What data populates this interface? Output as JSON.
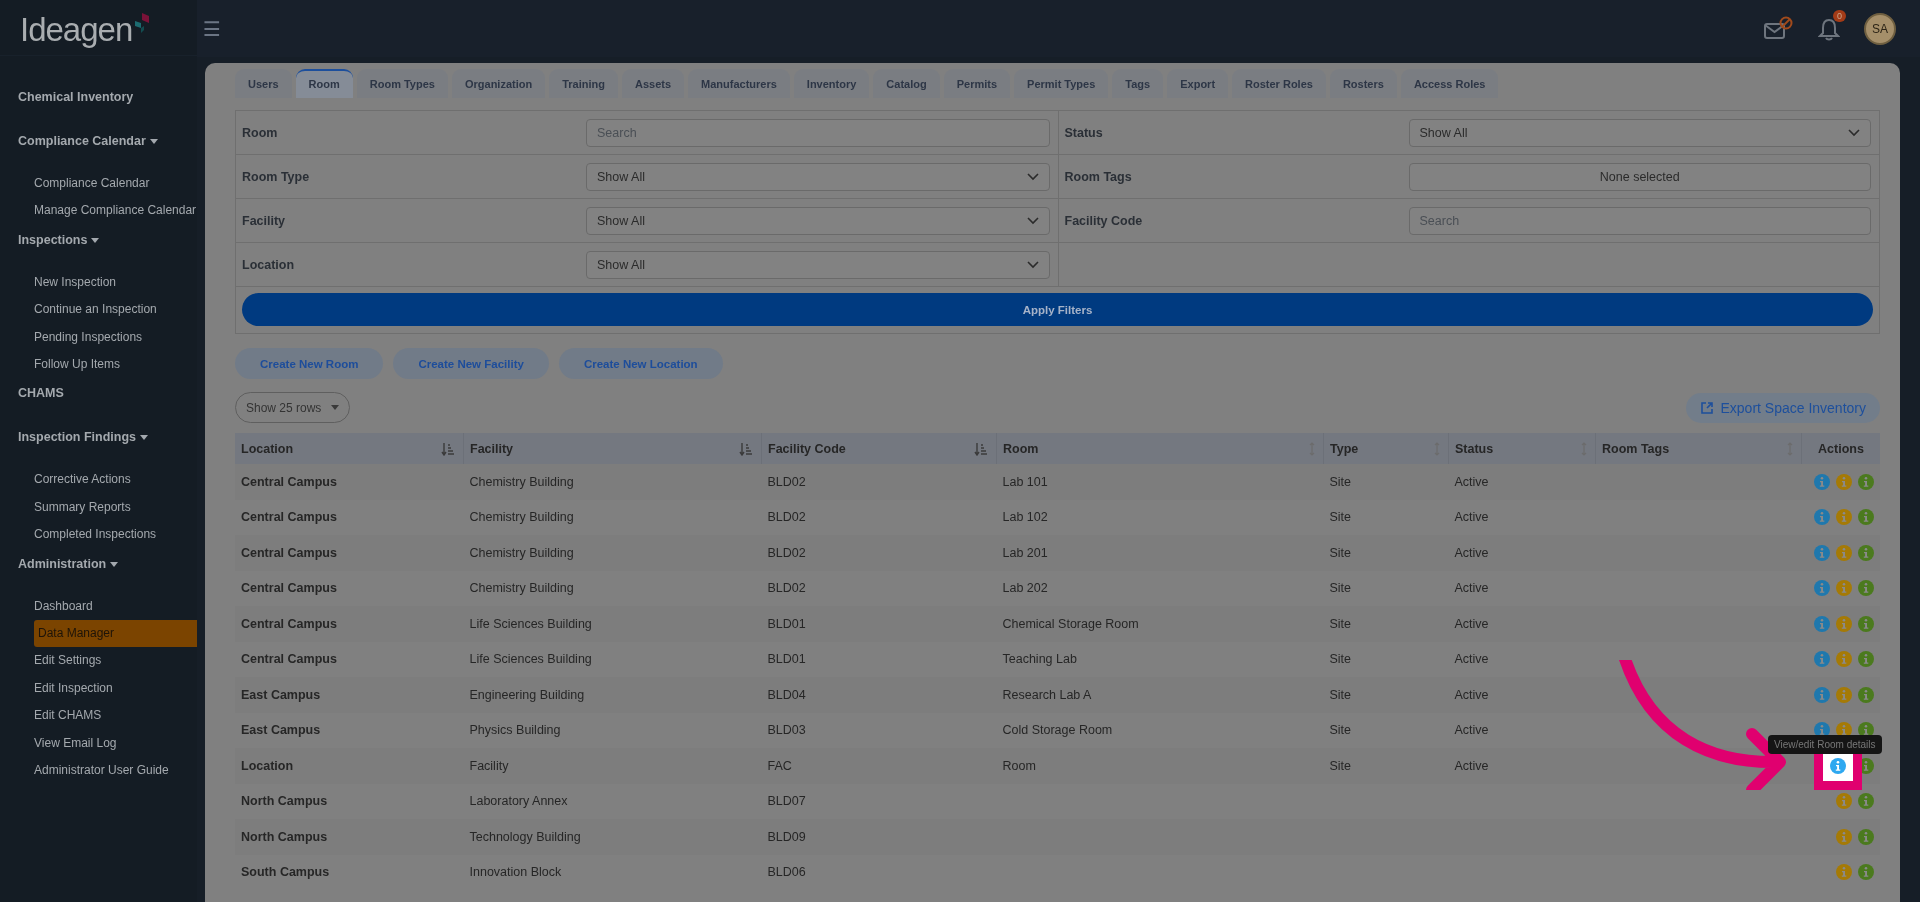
{
  "brand": {
    "logo": "Ideagen"
  },
  "top_bar": {
    "menu_icon": "☰",
    "notifications": {
      "count": "0"
    },
    "avatar": "SA"
  },
  "sidebar": {
    "sections": [
      {
        "title": "Chemical Inventory"
      },
      {
        "title": "Compliance Calendar",
        "items": [
          {
            "label": "Compliance Calendar",
            "selected": false
          },
          {
            "label": "Manage Compliance Calendar",
            "selected": false
          }
        ]
      },
      {
        "title": "Inspections",
        "items": [
          {
            "label": "New Inspection",
            "selected": false
          },
          {
            "label": "Continue an Inspection",
            "selected": false
          },
          {
            "label": "Pending Inspections",
            "selected": false
          },
          {
            "label": "Follow Up Items",
            "selected": false
          }
        ]
      },
      {
        "title": "CHAMS"
      },
      {
        "title": "Inspection Findings",
        "items": [
          {
            "label": "Corrective Actions",
            "selected": false
          },
          {
            "label": "Summary Reports",
            "selected": false
          },
          {
            "label": "Completed Inspections",
            "selected": false
          }
        ]
      },
      {
        "title": "Administration",
        "items": [
          {
            "label": "Dashboard",
            "selected": false
          },
          {
            "label": "Data Manager",
            "selected": true
          },
          {
            "label": "Edit Settings",
            "selected": false
          },
          {
            "label": "Edit Inspection",
            "selected": false
          },
          {
            "label": "Edit CHAMS",
            "selected": false
          },
          {
            "label": "View Email Log",
            "selected": false
          },
          {
            "label": "Administrator User Guide",
            "selected": false
          }
        ]
      }
    ]
  },
  "tabs": [
    {
      "label": "Users",
      "selected": false
    },
    {
      "label": "Room",
      "selected": true
    },
    {
      "label": "Room Types",
      "selected": false
    },
    {
      "label": "Organization",
      "selected": false
    },
    {
      "label": "Training",
      "selected": false
    },
    {
      "label": "Assets",
      "selected": false
    },
    {
      "label": "Manufacturers",
      "selected": false
    },
    {
      "label": "Inventory",
      "selected": false
    },
    {
      "label": "Catalog",
      "selected": false
    },
    {
      "label": "Permits",
      "selected": false
    },
    {
      "label": "Permit Types",
      "selected": false
    },
    {
      "label": "Tags",
      "selected": false
    },
    {
      "label": "Export",
      "selected": false
    },
    {
      "label": "Roster Roles",
      "selected": false
    },
    {
      "label": "Rosters",
      "selected": false
    },
    {
      "label": "Access Roles",
      "selected": false
    }
  ],
  "filters": [
    {
      "left": {
        "label": "Room",
        "kind": "text",
        "placeholder": "Search"
      },
      "right": {
        "label": "Status",
        "kind": "select",
        "value": "Show All"
      }
    },
    {
      "left": {
        "label": "Room Type",
        "kind": "select",
        "value": "Show All"
      },
      "right": {
        "label": "Room Tags",
        "kind": "multiselect",
        "value": "None selected"
      }
    },
    {
      "left": {
        "label": "Facility",
        "kind": "select",
        "value": "Show All"
      },
      "right": {
        "label": "Facility Code",
        "kind": "text",
        "placeholder": "Search"
      }
    },
    {
      "left": {
        "label": "Location",
        "kind": "select",
        "value": "Show All"
      }
    }
  ],
  "apply_button": "Apply Filters",
  "create_buttons": [
    "Create New Room",
    "Create New Facility",
    "Create New Location"
  ],
  "page_size": "Show 25 rows",
  "export_button": "Export Space Inventory",
  "table": {
    "columns": [
      {
        "label": "Location",
        "kind": "sorted"
      },
      {
        "label": "Facility",
        "kind": "sorted"
      },
      {
        "label": "Facility Code",
        "kind": "sorted"
      },
      {
        "label": "Room",
        "kind": "sortable"
      },
      {
        "label": "Type",
        "kind": "sortable"
      },
      {
        "label": "Status",
        "kind": "sortable"
      },
      {
        "label": "Room Tags",
        "kind": "sortable"
      },
      {
        "label": "Actions",
        "kind": "plain"
      }
    ],
    "rows": [
      {
        "location": "Central Campus",
        "facility": "Chemistry Building",
        "facility_code": "BLD02",
        "room": "Lab 101",
        "type": "Site",
        "status": "Active",
        "actions": [
          {
            "color": "#1f78ad",
            "highlighted": false
          },
          {
            "color": "#a57a06",
            "highlighted": false
          },
          {
            "color": "#4b7a1e",
            "highlighted": false
          }
        ]
      },
      {
        "location": "Central Campus",
        "facility": "Chemistry Building",
        "facility_code": "BLD02",
        "room": "Lab 102",
        "type": "Site",
        "status": "Active",
        "actions": [
          {
            "color": "#1f78ad",
            "highlighted": false
          },
          {
            "color": "#a57a06",
            "highlighted": false
          },
          {
            "color": "#4b7a1e",
            "highlighted": false
          }
        ]
      },
      {
        "location": "Central Campus",
        "facility": "Chemistry Building",
        "facility_code": "BLD02",
        "room": "Lab 201",
        "type": "Site",
        "status": "Active",
        "actions": [
          {
            "color": "#1f78ad",
            "highlighted": false
          },
          {
            "color": "#a57a06",
            "highlighted": false
          },
          {
            "color": "#4b7a1e",
            "highlighted": false
          }
        ]
      },
      {
        "location": "Central Campus",
        "facility": "Chemistry Building",
        "facility_code": "BLD02",
        "room": "Lab 202",
        "type": "Site",
        "status": "Active",
        "actions": [
          {
            "color": "#1f78ad",
            "highlighted": false
          },
          {
            "color": "#a57a06",
            "highlighted": false
          },
          {
            "color": "#4b7a1e",
            "highlighted": false
          }
        ]
      },
      {
        "location": "Central Campus",
        "facility": "Life Sciences Building",
        "facility_code": "BLD01",
        "room": "Chemical Storage Room",
        "type": "Site",
        "status": "Active",
        "actions": [
          {
            "color": "#1f78ad",
            "highlighted": false
          },
          {
            "color": "#a57a06",
            "highlighted": false
          },
          {
            "color": "#4b7a1e",
            "highlighted": false
          }
        ]
      },
      {
        "location": "Central Campus",
        "facility": "Life Sciences Building",
        "facility_code": "BLD01",
        "room": "Teaching Lab",
        "type": "Site",
        "status": "Active",
        "actions": [
          {
            "color": "#1f78ad",
            "highlighted": false
          },
          {
            "color": "#a57a06",
            "highlighted": false
          },
          {
            "color": "#4b7a1e",
            "highlighted": false
          }
        ]
      },
      {
        "location": "East Campus",
        "facility": "Engineering Building",
        "facility_code": "BLD04",
        "room": "Research Lab A",
        "type": "Site",
        "status": "Active",
        "actions": [
          {
            "color": "#1f78ad",
            "highlighted": false
          },
          {
            "color": "#a57a06",
            "highlighted": false
          },
          {
            "color": "#4b7a1e",
            "highlighted": false
          }
        ]
      },
      {
        "location": "East Campus",
        "facility": "Physics Building",
        "facility_code": "BLD03",
        "room": "Cold Storage Room",
        "type": "Site",
        "status": "Active",
        "actions": [
          {
            "color": "#1f78ad",
            "highlighted": false
          },
          {
            "color": "#a57a06",
            "highlighted": false
          },
          {
            "color": "#4b7a1e",
            "highlighted": false
          }
        ]
      },
      {
        "location": "Location",
        "facility": "Facility",
        "facility_code": "FAC",
        "room": "Room",
        "type": "Site",
        "status": "Active",
        "actions": [
          {
            "color": "#2ea8f0",
            "highlighted": true,
            "tooltip": "View/edit Room details"
          },
          {
            "color": "#4b7a1e",
            "highlighted": false
          }
        ]
      },
      {
        "location": "North Campus",
        "facility": "Laboratory Annex",
        "facility_code": "BLD07",
        "actions": [
          {
            "color": "#a57a06",
            "highlighted": false
          },
          {
            "color": "#4b7a1e",
            "highlighted": false
          }
        ]
      },
      {
        "location": "North Campus",
        "facility": "Technology Building",
        "facility_code": "BLD09",
        "actions": [
          {
            "color": "#a57a06",
            "highlighted": false
          },
          {
            "color": "#4b7a1e",
            "highlighted": false
          }
        ]
      },
      {
        "location": "South Campus",
        "facility": "Innovation Block",
        "facility_code": "BLD06",
        "actions": [
          {
            "color": "#a57a06",
            "highlighted": false
          },
          {
            "color": "#4b7a1e",
            "highlighted": false
          }
        ]
      }
    ]
  }
}
